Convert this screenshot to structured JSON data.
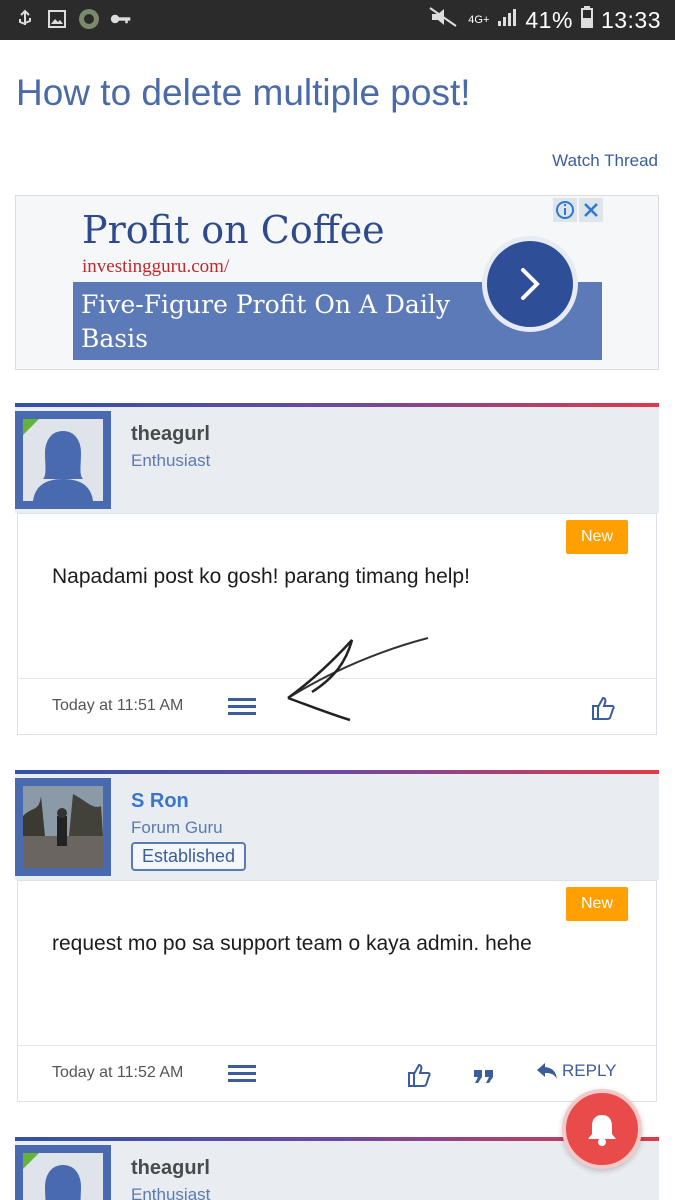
{
  "status_bar": {
    "battery_percent": "41%",
    "time": "13:33",
    "network": "4G+"
  },
  "thread": {
    "title": "How to delete multiple post!",
    "watch_label": "Watch Thread"
  },
  "ad": {
    "headline": "Profit on Coffee",
    "domain": "investingguru.com/",
    "description": "Five-Figure Profit On A Daily Basis"
  },
  "posts": [
    {
      "username": "theagurl",
      "user_title": "Enthusiast",
      "badge": "",
      "new_label": "New",
      "text": "Napadami post ko gosh! parang timang help!",
      "date": "Today at 11:51 AM"
    },
    {
      "username": "S Ron",
      "user_title": "Forum Guru",
      "badge": "Established",
      "new_label": "New",
      "text": "request mo po sa support team o kaya admin. hehe",
      "date": "Today at 11:52 AM",
      "reply_label": "REPLY"
    },
    {
      "username": "theagurl",
      "user_title": "Enthusiast"
    }
  ],
  "colors": {
    "accent": "#4a6aa8",
    "new_badge": "#ff9f00",
    "notification": "#e94a4a"
  }
}
